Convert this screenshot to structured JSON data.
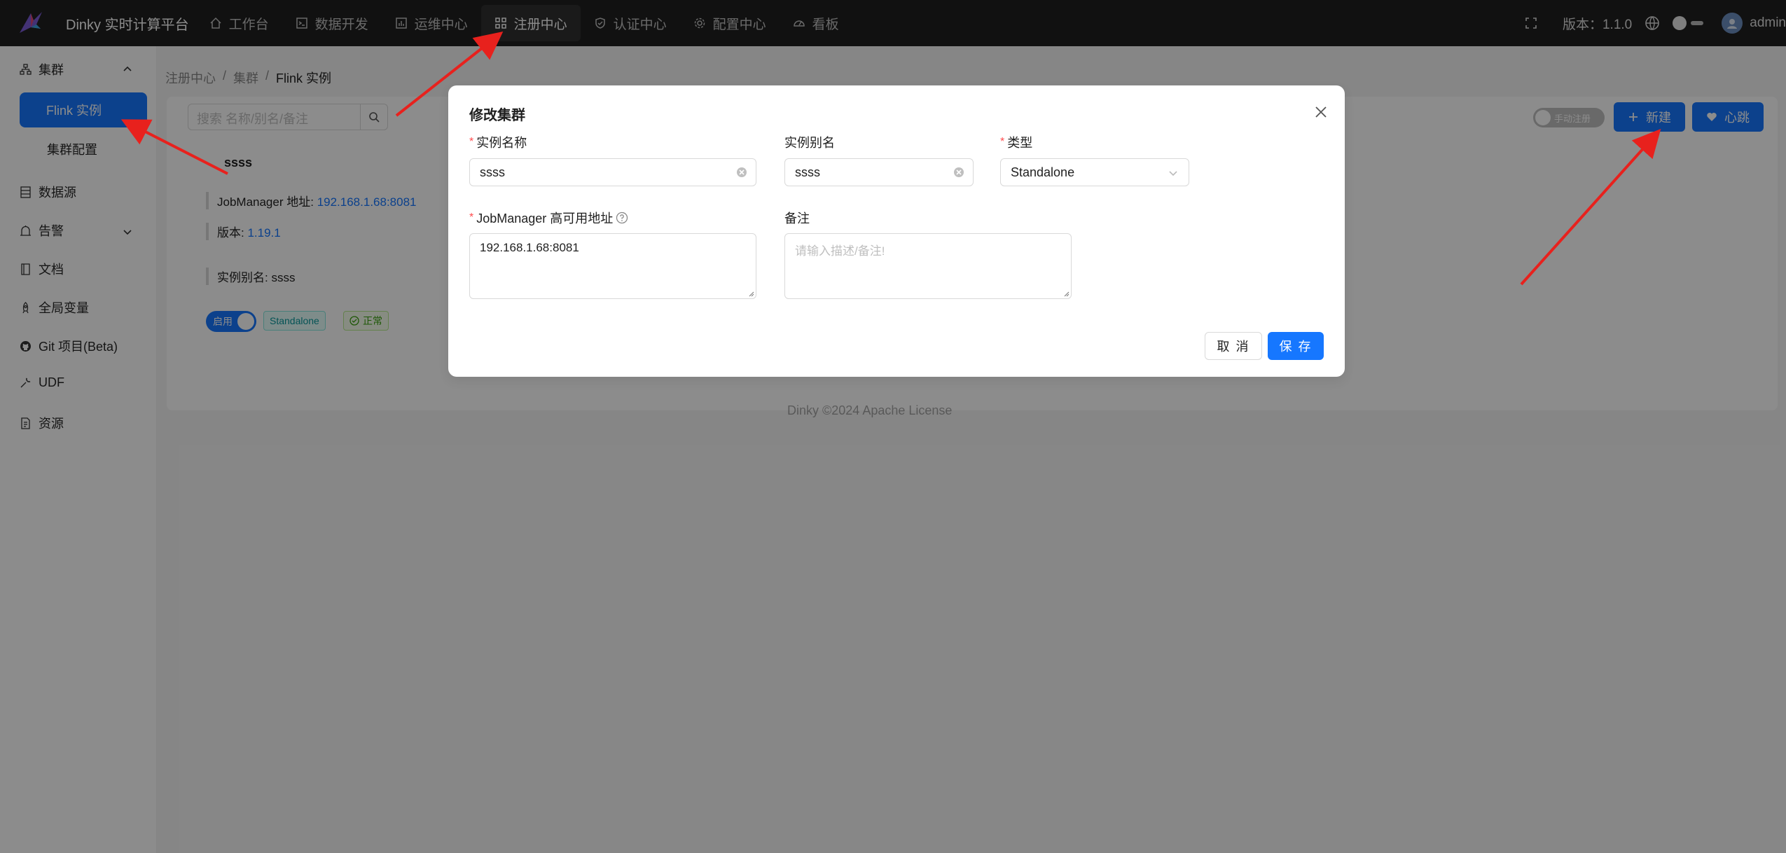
{
  "header": {
    "app_title": "Dinky 实时计算平台",
    "nav": [
      {
        "label": "工作台",
        "icon": "home-icon"
      },
      {
        "label": "数据开发",
        "icon": "code-icon"
      },
      {
        "label": "运维中心",
        "icon": "chart-icon"
      },
      {
        "label": "注册中心",
        "icon": "grid-icon",
        "active": true
      },
      {
        "label": "认证中心",
        "icon": "shield-icon"
      },
      {
        "label": "配置中心",
        "icon": "gear-icon"
      },
      {
        "label": "看板",
        "icon": "dashboard-icon"
      }
    ],
    "version": "版本：1.1.0",
    "user": "admin"
  },
  "sidebar": {
    "cluster": "集群",
    "flink_instance": "Flink 实例",
    "cluster_config": "集群配置",
    "datasource": "数据源",
    "alert": "告警",
    "docs": "文档",
    "global_vars": "全局变量",
    "git_project": "Git 项目(Beta)",
    "udf": "UDF",
    "resources": "资源"
  },
  "breadcrumb": [
    "注册中心",
    "/",
    "集群",
    "/",
    "Flink 实例"
  ],
  "toolbar": {
    "search_placeholder": "搜索 名称/别名/备注",
    "manual_register": "手动注册",
    "new_label": "新建",
    "heartbeat_label": "心跳"
  },
  "instance_card": {
    "name": "ssss",
    "jobmanager_label": "JobManager 地址: ",
    "jobmanager_value": "192.168.1.68:8081",
    "version_label": "版本: ",
    "version_value": "1.19.1",
    "alias_line": "实例别名: ssss",
    "enabled_label": "启用",
    "type_tag": "Standalone",
    "status_tag": "正常"
  },
  "footer": "Dinky ©2024 Apache License",
  "modal": {
    "title": "修改集群",
    "fields": {
      "name_label": "实例名称",
      "name_value": "ssss",
      "alias_label": "实例别名",
      "alias_value": "ssss",
      "type_label": "类型",
      "type_value": "Standalone",
      "ha_label": "JobManager 高可用地址",
      "ha_value": "192.168.1.68:8081",
      "note_label": "备注",
      "note_placeholder": "请输入描述/备注!"
    },
    "cancel_label": "取 消",
    "save_label": "保 存"
  },
  "colors": {
    "primary": "#1677ff",
    "header_bg": "#1f1f1f",
    "required": "#ff4d4f",
    "annotation_arrow": "#e8211d"
  }
}
